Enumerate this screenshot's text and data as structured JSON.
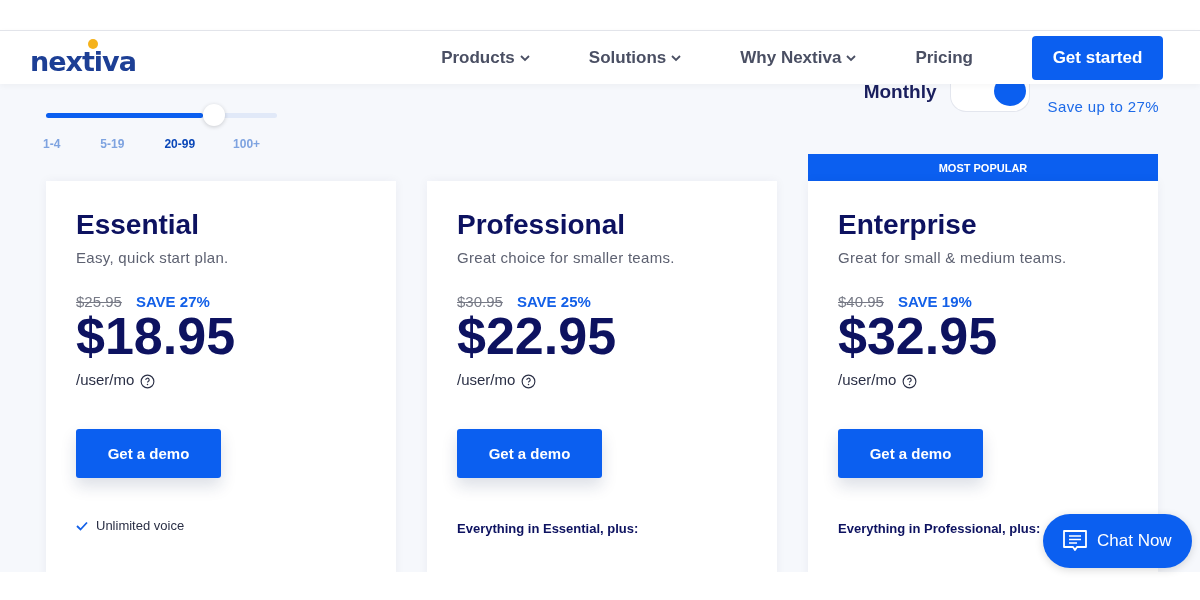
{
  "header": {
    "logo": "nextiva",
    "nav": [
      {
        "label": "Products",
        "dropdown": true
      },
      {
        "label": "Solutions",
        "dropdown": true
      },
      {
        "label": "Why Nextiva",
        "dropdown": true
      },
      {
        "label": "Pricing",
        "dropdown": false
      }
    ],
    "cta": "Get started"
  },
  "users": {
    "level": 0.68,
    "options": [
      {
        "label": "1-4",
        "selected": false
      },
      {
        "label": "5-19",
        "selected": false
      },
      {
        "label": "20-99",
        "selected": true
      },
      {
        "label": "100+",
        "selected": false
      }
    ]
  },
  "billing": {
    "label": "Monthly",
    "annual": true,
    "note": "Save up to 27%"
  },
  "plans": [
    {
      "name": "Essential",
      "tagline": "Easy, quick start plan.",
      "old_price": "$25.95",
      "save": "SAVE 27%",
      "price": "$18.95",
      "unit": "/user/mo",
      "button": "Get a demo",
      "popular": false,
      "features": [
        {
          "kind": "check",
          "text": "Unlimited voice"
        }
      ]
    },
    {
      "name": "Professional",
      "tagline": "Great choice for smaller teams.",
      "old_price": "$30.95",
      "save": "SAVE 25%",
      "price": "$22.95",
      "unit": "/user/mo",
      "button": "Get a demo",
      "popular": false,
      "features": [
        {
          "kind": "heading",
          "text": "Everything in Essential, plus:"
        }
      ]
    },
    {
      "name": "Enterprise",
      "tagline": "Great for small & medium teams.",
      "old_price": "$40.95",
      "save": "SAVE 19%",
      "price": "$32.95",
      "unit": "/user/mo",
      "button": "Get a demo",
      "popular": true,
      "badge": "MOST POPULAR",
      "features": [
        {
          "kind": "heading",
          "text": "Everything in Professional, plus:"
        }
      ]
    }
  ],
  "chat": {
    "label": "Chat Now"
  }
}
